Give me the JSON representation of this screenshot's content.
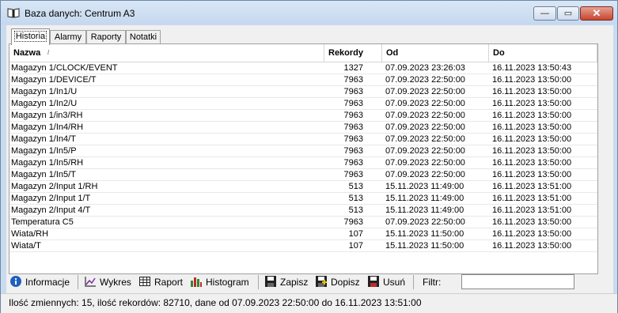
{
  "window": {
    "title": "Baza danych: Centrum A3",
    "minimize_glyph": "—",
    "maximize_glyph": "▭",
    "close_glyph": "✕"
  },
  "tabs": [
    {
      "label": "Historia",
      "active": true
    },
    {
      "label": "Alarmy",
      "active": false
    },
    {
      "label": "Raporty",
      "active": false
    },
    {
      "label": "Notatki",
      "active": false
    }
  ],
  "table": {
    "columns": [
      "Nazwa",
      "Rekordy",
      "Od",
      "Do"
    ],
    "sorted_column": "Nazwa",
    "rows": [
      [
        "Magazyn 1/CLOCK/EVENT",
        "1327",
        "07.09.2023 23:26:03",
        "16.11.2023 13:50:43"
      ],
      [
        "Magazyn 1/DEVICE/T",
        "7963",
        "07.09.2023 22:50:00",
        "16.11.2023 13:50:00"
      ],
      [
        "Magazyn 1/In1/U",
        "7963",
        "07.09.2023 22:50:00",
        "16.11.2023 13:50:00"
      ],
      [
        "Magazyn 1/In2/U",
        "7963",
        "07.09.2023 22:50:00",
        "16.11.2023 13:50:00"
      ],
      [
        "Magazyn 1/in3/RH",
        "7963",
        "07.09.2023 22:50:00",
        "16.11.2023 13:50:00"
      ],
      [
        "Magazyn 1/In4/RH",
        "7963",
        "07.09.2023 22:50:00",
        "16.11.2023 13:50:00"
      ],
      [
        "Magazyn 1/In4/T",
        "7963",
        "07.09.2023 22:50:00",
        "16.11.2023 13:50:00"
      ],
      [
        "Magazyn 1/In5/P",
        "7963",
        "07.09.2023 22:50:00",
        "16.11.2023 13:50:00"
      ],
      [
        "Magazyn 1/In5/RH",
        "7963",
        "07.09.2023 22:50:00",
        "16.11.2023 13:50:00"
      ],
      [
        "Magazyn 1/In5/T",
        "7963",
        "07.09.2023 22:50:00",
        "16.11.2023 13:50:00"
      ],
      [
        "Magazyn 2/Input 1/RH",
        "513",
        "15.11.2023 11:49:00",
        "16.11.2023 13:51:00"
      ],
      [
        "Magazyn 2/Input 1/T",
        "513",
        "15.11.2023 11:49:00",
        "16.11.2023 13:51:00"
      ],
      [
        "Magazyn 2/Input 4/T",
        "513",
        "15.11.2023 11:49:00",
        "16.11.2023 13:51:00"
      ],
      [
        "Temperatura C5",
        "7963",
        "07.09.2023 22:50:00",
        "16.11.2023 13:50:00"
      ],
      [
        "Wiata/RH",
        "107",
        "15.11.2023 11:50:00",
        "16.11.2023 13:50:00"
      ],
      [
        "Wiata/T",
        "107",
        "15.11.2023 11:50:00",
        "16.11.2023 13:50:00"
      ]
    ]
  },
  "toolbar": {
    "info": "Informacje",
    "chart": "Wykres",
    "report": "Raport",
    "histogram": "Histogram",
    "save": "Zapisz",
    "append": "Dopisz",
    "delete": "Usuń",
    "filter_label": "Filtr:",
    "filter_value": ""
  },
  "status": {
    "text": "Ilość zmiennych: 15, ilość rekordów: 82710, dane od 07.09.2023 22:50:00 do 16.11.2023 13:51:00"
  },
  "colors": {
    "titlebar": "#c9dbef",
    "close_button": "#c7462f",
    "info_icon": "#1e5fc0",
    "histogram_icon": "#2d8a2d"
  }
}
